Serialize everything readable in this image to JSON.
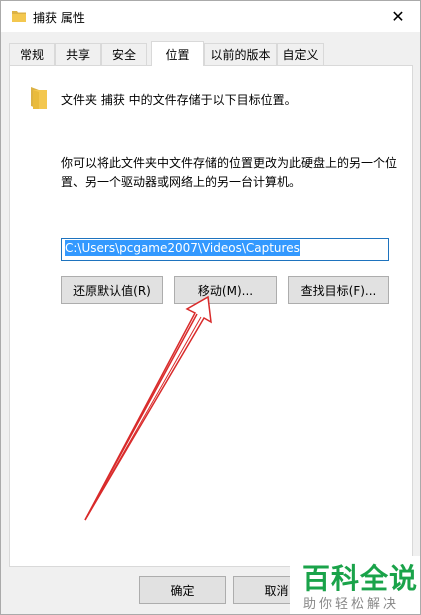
{
  "window": {
    "title": "捕获 属性",
    "close_glyph": "✕"
  },
  "tabs": [
    {
      "label": "常规"
    },
    {
      "label": "共享"
    },
    {
      "label": "安全"
    },
    {
      "label": "位置"
    },
    {
      "label": "以前的版本"
    },
    {
      "label": "自定义"
    }
  ],
  "location": {
    "folder_description": "文件夹 捕获 中的文件存储于以下目标位置。",
    "info_text": "你可以将此文件夹中文件存储的位置更改为此硬盘上的另一个位置、另一个驱动器或网络上的另一台计算机。",
    "path_value": "C:\\Users\\pcgame2007\\Videos\\Captures",
    "restore_label": "还原默认值(R)",
    "move_label": "移动(M)...",
    "find_label": "查找目标(F)..."
  },
  "footer": {
    "ok_label": "确定",
    "cancel_label": "取消"
  },
  "watermark": {
    "main": "百科全说",
    "sub": "助你轻松解决"
  },
  "colors": {
    "selection": "#3399ff",
    "arrow": "#d92b2b",
    "watermark_green": "#1aa34a",
    "folder_yellow": "#f3c74f"
  },
  "icons": {
    "title_icon": "folder-icon",
    "close": "close-icon",
    "folder": "folder-icon"
  }
}
